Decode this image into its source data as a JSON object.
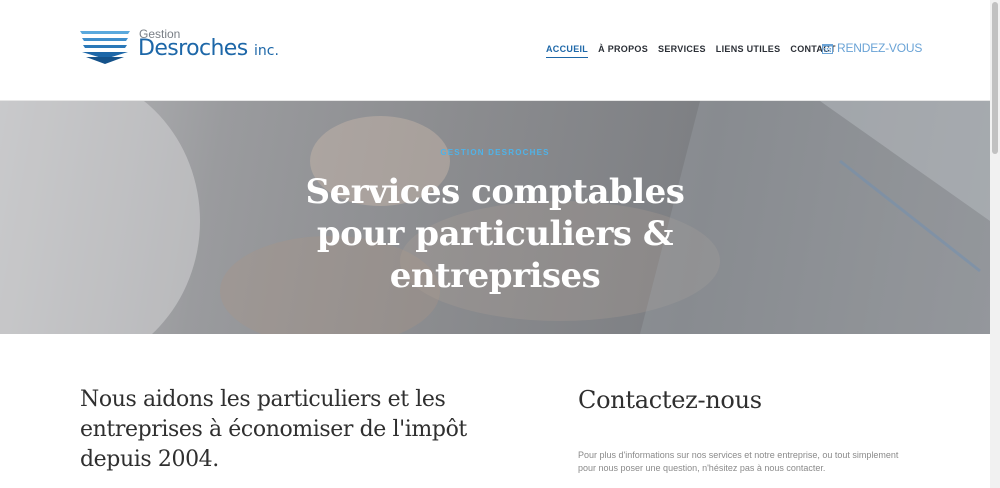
{
  "logo": {
    "small": "Gestion",
    "big": "Desroches",
    "suffix": "inc."
  },
  "nav": {
    "items": [
      {
        "label": "ACCUEIL"
      },
      {
        "label": "À PROPOS"
      },
      {
        "label": "SERVICES"
      },
      {
        "label": "LIENS UTILES"
      },
      {
        "label": "CONTACT"
      }
    ],
    "active_index": 0
  },
  "cta": {
    "label": "RENDEZ-VOUS",
    "icon": "calendar-icon"
  },
  "hero": {
    "kicker": "GESTION DESROCHES",
    "title_lines": [
      "Services comptables",
      "pour particuliers &",
      "entreprises"
    ]
  },
  "intro": {
    "lines": [
      "Nous aidons les particuliers et les",
      "entreprises à économiser de l'impôt",
      "depuis 2004."
    ]
  },
  "contact": {
    "title": "Contactez-nous",
    "text": "Pour plus d'informations sur nos services et notre entreprise, ou tout simplement pour nous poser une question, n'hésitez pas à nous contacter."
  },
  "colors": {
    "brand": "#1d67a8",
    "accent": "#4fb3e8",
    "cta": "#6aa3d6"
  }
}
